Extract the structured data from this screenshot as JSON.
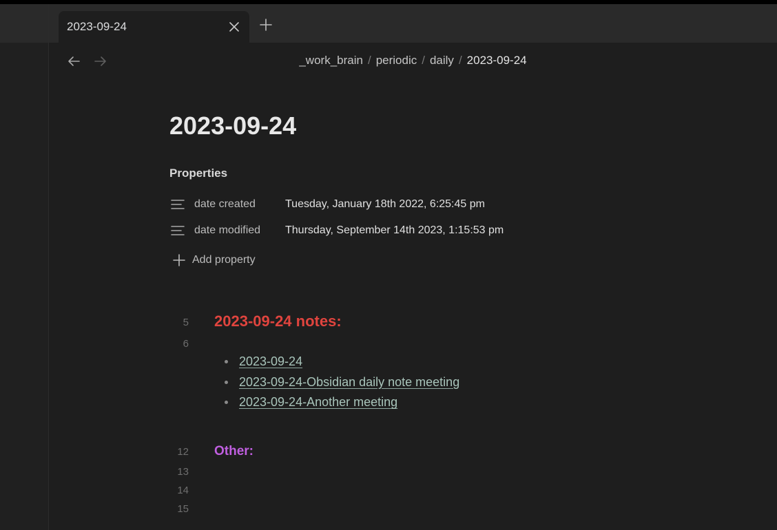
{
  "tab": {
    "title": "2023-09-24"
  },
  "breadcrumb": {
    "parts": [
      "_work_brain",
      "periodic",
      "daily"
    ],
    "current": "2023-09-24",
    "separator": "/"
  },
  "note": {
    "title": "2023-09-24",
    "properties_heading": "Properties",
    "properties": [
      {
        "key": "date created",
        "value": "Tuesday, January 18th 2022, 6:25:45 pm",
        "icon": "text-lines-icon"
      },
      {
        "key": "date modified",
        "value": "Thursday, September 14th 2023, 1:15:53 pm",
        "icon": "text-lines-icon"
      }
    ],
    "add_property_label": "Add property",
    "line_numbers": [
      "5",
      "6",
      "12",
      "13",
      "14",
      "15"
    ],
    "heading_notes": "2023-09-24 notes:",
    "links": [
      "2023-09-24",
      "2023-09-24-Obsidian daily note meeting",
      "2023-09-24-Another meeting"
    ],
    "heading_other": "Other:"
  },
  "colors": {
    "background": "#1e1e1e",
    "heading_notes": "#e0443e",
    "heading_other": "#c05fe0",
    "link": "#a9c5bb"
  }
}
